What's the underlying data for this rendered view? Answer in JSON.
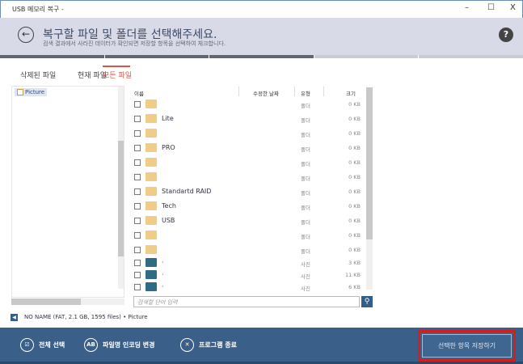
{
  "window": {
    "title": "USB 메모리 복구 -",
    "minimize": "–",
    "maximize": "☐",
    "close": "X"
  },
  "header": {
    "title": "복구할 파일 및 폴더를 선택해주세요.",
    "subtitle": "검색 결과에서 사라진 데이터가 확인되면 저장할 항목을 선택하여 체크합니다.",
    "back": "←",
    "help": "?"
  },
  "progress": {
    "steps_total": 5,
    "steps_done": 3
  },
  "tabs": [
    {
      "label": "삭제된 파일"
    },
    {
      "label": "현재 파일"
    },
    {
      "label": "모든 파일",
      "active": true
    }
  ],
  "tree": {
    "root": "Picture"
  },
  "columns": {
    "name": "이름",
    "modified": "수정한 날짜",
    "type": "유형",
    "size": "크기"
  },
  "rows": [
    {
      "name": "",
      "type": "폴더",
      "size": "0 KB",
      "icon": "folder"
    },
    {
      "name": "Lite",
      "type": "폴더",
      "size": "0 KB",
      "icon": "folder"
    },
    {
      "name": "",
      "type": "폴더",
      "size": "0 KB",
      "icon": "folder"
    },
    {
      "name": "PRO",
      "type": "폴더",
      "size": "0 KB",
      "icon": "folder"
    },
    {
      "name": "",
      "type": "폴더",
      "size": "0 KB",
      "icon": "folder"
    },
    {
      "name": "",
      "type": "폴더",
      "size": "0 KB",
      "icon": "folder"
    },
    {
      "name": "Standartd RAID",
      "type": "폴더",
      "size": "0 KB",
      "icon": "folder"
    },
    {
      "name": "Tech",
      "type": "폴더",
      "size": "0 KB",
      "icon": "folder"
    },
    {
      "name": "USB",
      "type": "폴더",
      "size": "0 KB",
      "icon": "folder"
    },
    {
      "name": "",
      "type": "폴더",
      "size": "0 KB",
      "icon": "folder"
    },
    {
      "name": "",
      "type": "폴더",
      "size": "0 KB",
      "icon": "folder"
    },
    {
      "name": "·",
      "type": "사진",
      "size": "3 KB",
      "icon": "image"
    },
    {
      "name": "·",
      "type": "사진",
      "size": "11 KB",
      "icon": "image"
    },
    {
      "name": "·",
      "type": "사진",
      "size": "6 KB",
      "icon": "image"
    }
  ],
  "search": {
    "placeholder": "검색할 단어 입력",
    "button": "⚲"
  },
  "status": {
    "drive": "NO NAME (FAT, 2.1 GB, 1595 files)",
    "sep": "•",
    "path": "Picture",
    "arrow": "◀"
  },
  "footer": {
    "select_all": "전체 선택",
    "encoding": "파일명 인코딩 변경",
    "exit": "프로그램 종료",
    "save": "선택한 항목 저장하기",
    "encoding_icon": "AB",
    "exit_icon": "✕",
    "select_icon": "☑"
  }
}
